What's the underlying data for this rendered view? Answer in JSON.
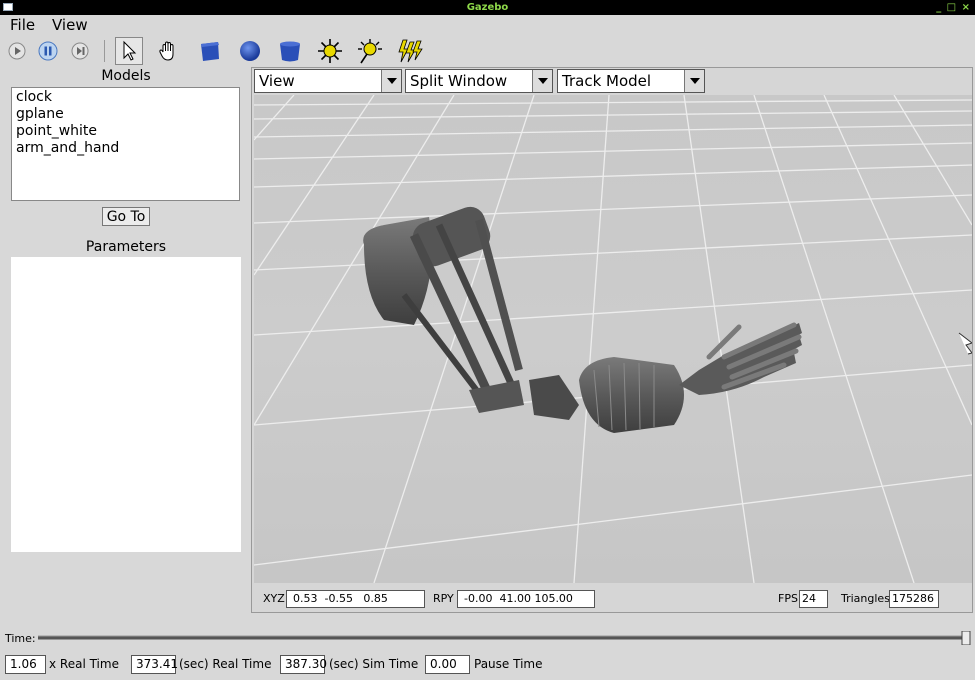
{
  "window": {
    "title": "Gazebo",
    "controls": "_ □ ×"
  },
  "menu": {
    "file": "File",
    "view": "View"
  },
  "toolbar": {
    "icons": [
      "play-icon",
      "pause-icon",
      "step-icon",
      "select-cursor-icon",
      "hand-pan-icon",
      "box-icon",
      "sphere-icon",
      "cylinder-icon",
      "point-light-icon",
      "spot-light-icon",
      "directional-light-icon"
    ]
  },
  "models": {
    "title": "Models",
    "items": [
      "clock",
      "gplane",
      "point_white",
      "arm_and_hand"
    ],
    "goto_label": "Go To"
  },
  "parameters": {
    "title": "Parameters"
  },
  "viewport": {
    "view_dropdown": "View",
    "split_dropdown": "Split Window",
    "track_dropdown": "Track Model"
  },
  "status": {
    "xyz_label": "XYZ",
    "xyz_value": "0.53  -0.55   0.85",
    "rpy_label": "RPY",
    "rpy_value": "-0.00  41.00 105.00",
    "fps_label": "FPS",
    "fps_value": "24",
    "triangles_label": "Triangles",
    "triangles_value": "175286"
  },
  "time": {
    "label": "Time:",
    "progress": 1.0,
    "real_time_factor": "1.06",
    "real_time_factor_label": "x Real Time",
    "real_time": "373.41",
    "real_time_label": "(sec) Real Time",
    "sim_time": "387.30",
    "sim_time_label": "(sec) Sim Time",
    "pause_time": "0.00",
    "pause_time_label": "Pause Time"
  },
  "colors": {
    "title_text": "#8ed84a",
    "shape_blue": "#2a4fb8",
    "light_yellow": "#e8d800"
  }
}
